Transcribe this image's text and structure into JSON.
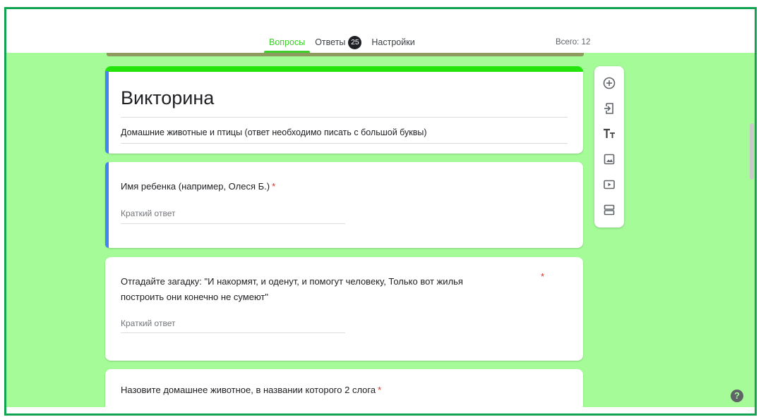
{
  "tabs": [
    {
      "label": "Вопросы",
      "active": true
    },
    {
      "label": "Ответы",
      "badge": "25"
    },
    {
      "label": "Настройки"
    }
  ],
  "total_label": "Всего: 12",
  "form": {
    "title": "Викторина",
    "description": "Домашние животные и птицы (ответ необходимо писать с большой буквы)"
  },
  "questions": [
    {
      "text": "Имя ребенка (например, Олеся Б.)",
      "required_mark": "*",
      "answer_placeholder": "Краткий ответ"
    },
    {
      "text_line1": "Отгадайте загадку: \"И накормят, и оденут, и помогут человеку, Только вот жилья",
      "text_line2": "построить они конечно не сумеют\"",
      "required_mark": "*",
      "answer_placeholder": "Краткий ответ"
    },
    {
      "text": "Назовите домашнее животное, в названии которого 2 слога",
      "required_mark": "*"
    }
  ],
  "sidebar_icons": [
    "add-question-icon",
    "import-questions-icon",
    "add-title-icon",
    "add-image-icon",
    "add-video-icon",
    "add-section-icon"
  ],
  "help_label": "?",
  "colors": {
    "accent": "#3fcf2c",
    "background": "#a4fb98",
    "title_bar": "#24e40c",
    "focus_bar": "#4285f4",
    "frame": "#12a350"
  }
}
